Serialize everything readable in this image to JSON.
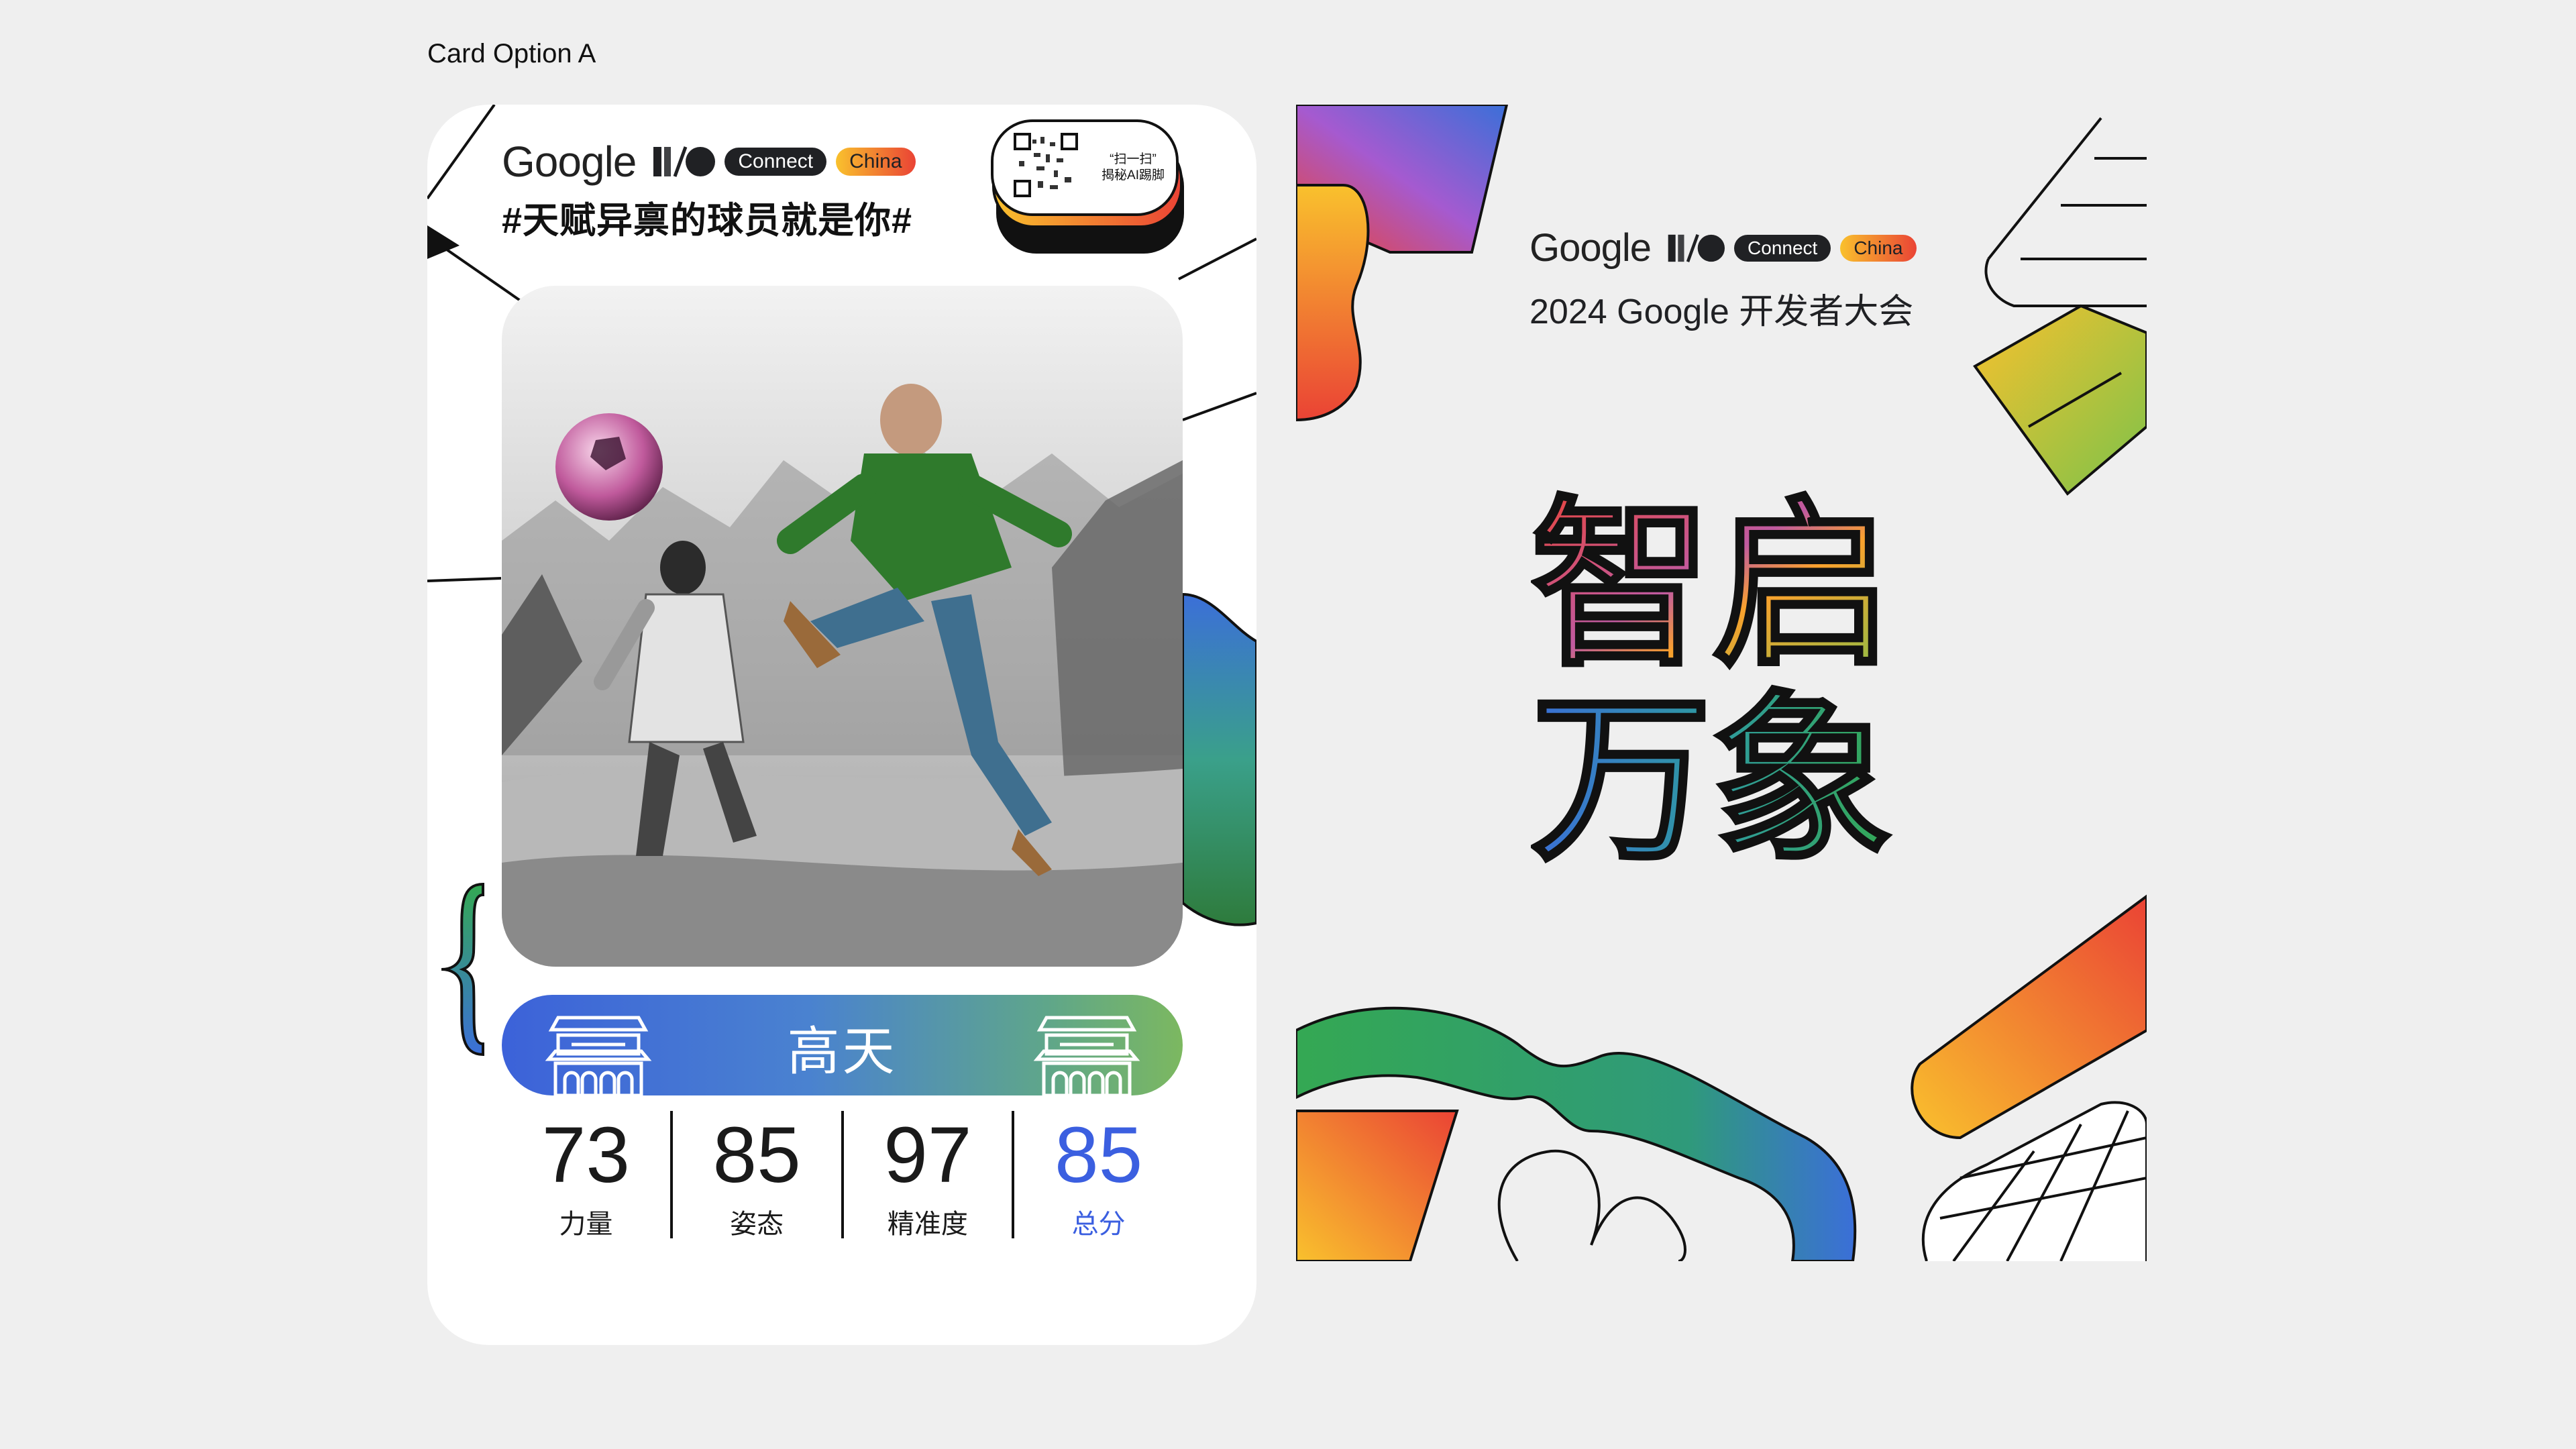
{
  "page_label": "Card Option A",
  "card_a": {
    "brand": {
      "google": "Google",
      "io": "I/O",
      "connect": "Connect",
      "china": "China"
    },
    "hashtag": "#天赋异禀的球员就是你#",
    "qr": {
      "line1": "“扫一扫”",
      "line2": "揭秘AI踢脚"
    },
    "player_name": "高天",
    "stats": [
      {
        "value": "73",
        "label": "力量"
      },
      {
        "value": "85",
        "label": "姿态"
      },
      {
        "value": "97",
        "label": "精准度"
      },
      {
        "value": "85",
        "label": "总分"
      }
    ],
    "colors": {
      "accent_blue": "#3b5fe0",
      "name_bar_start": "#3c62d9",
      "name_bar_end": "#7cb860"
    }
  },
  "card_b": {
    "brand": {
      "google": "Google",
      "io": "I/O",
      "connect": "Connect",
      "china": "China"
    },
    "subtitle": "2024 Google 开发者大会",
    "hero_line1": "智启",
    "hero_line2": "万象"
  },
  "icons": [
    "io-logo-icon",
    "qr-code-icon",
    "gate-icon",
    "curly-brace-icon"
  ]
}
